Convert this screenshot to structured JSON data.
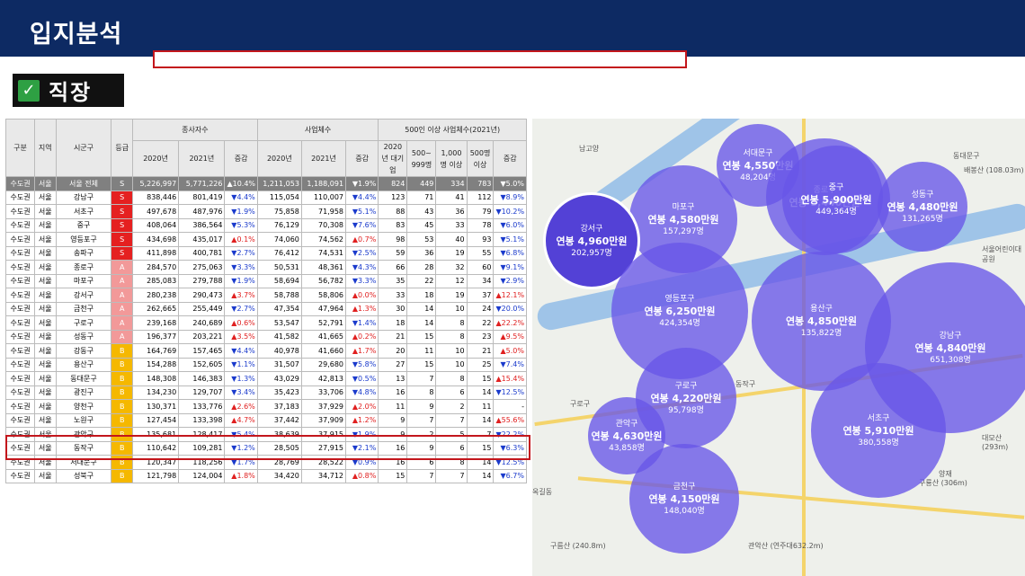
{
  "title": "입지분석",
  "section": "직장",
  "table": {
    "head1": [
      "구분",
      "지역",
      "시군구",
      "등급",
      "종사자수",
      "사업체수",
      "500인 이상 사업체수(2021년)"
    ],
    "head2": [
      "2020년",
      "2021년",
      "증감",
      "2020년",
      "2021년",
      "증감",
      "2020년 대기업",
      "500~ 999명",
      "1,000명 이상",
      "500명 이상",
      "증감"
    ],
    "rows": [
      [
        "수도권",
        "서울",
        "서울 전체",
        "S",
        "5,226,997",
        "5,771,226",
        "▲10.4%",
        "1,211,053",
        "1,188,091",
        "▼1.9%",
        "824",
        "449",
        "334",
        "783",
        "▼5.0%"
      ],
      [
        "수도권",
        "서울",
        "강남구",
        "S",
        "838,446",
        "801,419",
        "▼4.4%",
        "115,054",
        "110,007",
        "▼4.4%",
        "123",
        "71",
        "41",
        "112",
        "▼8.9%"
      ],
      [
        "수도권",
        "서울",
        "서초구",
        "S",
        "497,678",
        "487,976",
        "▼1.9%",
        "75,858",
        "71,958",
        "▼5.1%",
        "88",
        "43",
        "36",
        "79",
        "▼10.2%"
      ],
      [
        "수도권",
        "서울",
        "중구",
        "S",
        "408,064",
        "386,564",
        "▼5.3%",
        "76,129",
        "70,308",
        "▼7.6%",
        "83",
        "45",
        "33",
        "78",
        "▼6.0%"
      ],
      [
        "수도권",
        "서울",
        "영등포구",
        "S",
        "434,698",
        "435,017",
        "▲0.1%",
        "74,060",
        "74,562",
        "▲0.7%",
        "98",
        "53",
        "40",
        "93",
        "▼5.1%"
      ],
      [
        "수도권",
        "서울",
        "송파구",
        "S",
        "411,898",
        "400,781",
        "▼2.7%",
        "76,412",
        "74,531",
        "▼2.5%",
        "59",
        "36",
        "19",
        "55",
        "▼6.8%"
      ],
      [
        "수도권",
        "서울",
        "종로구",
        "A",
        "284,570",
        "275,063",
        "▼3.3%",
        "50,531",
        "48,361",
        "▼4.3%",
        "66",
        "28",
        "32",
        "60",
        "▼9.1%"
      ],
      [
        "수도권",
        "서울",
        "마포구",
        "A",
        "285,083",
        "279,788",
        "▼1.9%",
        "58,694",
        "56,782",
        "▼3.3%",
        "35",
        "22",
        "12",
        "34",
        "▼2.9%"
      ],
      [
        "수도권",
        "서울",
        "강서구",
        "A",
        "280,238",
        "290,473",
        "▲3.7%",
        "58,788",
        "58,806",
        "▲0.0%",
        "33",
        "18",
        "19",
        "37",
        "▲12.1%"
      ],
      [
        "수도권",
        "서울",
        "금천구",
        "A",
        "262,665",
        "255,449",
        "▼2.7%",
        "47,354",
        "47,964",
        "▲1.3%",
        "30",
        "14",
        "10",
        "24",
        "▼20.0%"
      ],
      [
        "수도권",
        "서울",
        "구로구",
        "A",
        "239,168",
        "240,689",
        "▲0.6%",
        "53,547",
        "52,791",
        "▼1.4%",
        "18",
        "14",
        "8",
        "22",
        "▲22.2%"
      ],
      [
        "수도권",
        "서울",
        "성동구",
        "A",
        "196,377",
        "203,221",
        "▲3.5%",
        "41,582",
        "41,665",
        "▲0.2%",
        "21",
        "15",
        "8",
        "23",
        "▲9.5%"
      ],
      [
        "수도권",
        "서울",
        "강동구",
        "B",
        "164,769",
        "157,465",
        "▼4.4%",
        "40,978",
        "41,660",
        "▲1.7%",
        "20",
        "11",
        "10",
        "21",
        "▲5.0%"
      ],
      [
        "수도권",
        "서울",
        "용산구",
        "B",
        "154,288",
        "152,605",
        "▼1.1%",
        "31,507",
        "29,680",
        "▼5.8%",
        "27",
        "15",
        "10",
        "25",
        "▼7.4%"
      ],
      [
        "수도권",
        "서울",
        "동대문구",
        "B",
        "148,308",
        "146,383",
        "▼1.3%",
        "43,029",
        "42,813",
        "▼0.5%",
        "13",
        "7",
        "8",
        "15",
        "▲15.4%"
      ],
      [
        "수도권",
        "서울",
        "광진구",
        "B",
        "134,230",
        "129,707",
        "▼3.4%",
        "35,423",
        "33,706",
        "▼4.8%",
        "16",
        "8",
        "6",
        "14",
        "▼12.5%"
      ],
      [
        "수도권",
        "서울",
        "양천구",
        "B",
        "130,371",
        "133,776",
        "▲2.6%",
        "37,183",
        "37,929",
        "▲2.0%",
        "11",
        "9",
        "2",
        "11",
        "-"
      ],
      [
        "수도권",
        "서울",
        "노원구",
        "B",
        "127,454",
        "133,398",
        "▲4.7%",
        "37,442",
        "37,909",
        "▲1.2%",
        "9",
        "7",
        "7",
        "14",
        "▲55.6%"
      ],
      [
        "수도권",
        "서울",
        "관악구",
        "B",
        "135,681",
        "128,417",
        "▼5.4%",
        "38,639",
        "37,915",
        "▼1.9%",
        "9",
        "2",
        "5",
        "7",
        "▼22.2%"
      ],
      [
        "수도권",
        "서울",
        "동작구",
        "B",
        "110,642",
        "109,281",
        "▼1.2%",
        "28,505",
        "27,915",
        "▼2.1%",
        "16",
        "9",
        "6",
        "15",
        "▼6.3%"
      ],
      [
        "수도권",
        "서울",
        "서대문구",
        "B",
        "120,347",
        "118,256",
        "▼1.7%",
        "28,769",
        "28,522",
        "▼0.9%",
        "16",
        "6",
        "8",
        "14",
        "▼12.5%"
      ],
      [
        "수도권",
        "서울",
        "성북구",
        "B",
        "121,798",
        "124,004",
        "▲1.8%",
        "34,420",
        "34,712",
        "▲0.8%",
        "15",
        "7",
        "7",
        "14",
        "▼6.7%"
      ]
    ]
  },
  "map": {
    "bubbles": [
      {
        "name": "서대문구",
        "salary": "연봉 4,550만원",
        "count": "48,204명"
      },
      {
        "name": "마포구",
        "salary": "연봉 4,580만원",
        "count": "157,297명"
      },
      {
        "name": "종로구",
        "salary": "연봉 5,440만원",
        "count": ""
      },
      {
        "name": "중구",
        "salary": "연봉 5,900만원",
        "count": "449,364명"
      },
      {
        "name": "성동구",
        "salary": "연봉 4,480만원",
        "count": "131,265명"
      },
      {
        "name": "강서구",
        "salary": "연봉 4,960만원",
        "count": "202,957명"
      },
      {
        "name": "영등포구",
        "salary": "연봉 6,250만원",
        "count": "424,354명"
      },
      {
        "name": "용산구",
        "salary": "연봉 4,850만원",
        "count": "135,822명"
      },
      {
        "name": "강남구",
        "salary": "연봉 4,840만원",
        "count": "651,308명"
      },
      {
        "name": "구로구",
        "salary": "연봉 4,220만원",
        "count": "95,798명"
      },
      {
        "name": "관악구",
        "salary": "연봉 4,630만원",
        "count": "43,858명"
      },
      {
        "name": "서초구",
        "salary": "연봉 5,910만원",
        "count": "380,558명"
      },
      {
        "name": "금천구",
        "salary": "연봉 4,150만원",
        "count": "148,040명"
      }
    ],
    "labels": [
      "동작구",
      "구로구",
      "동대문구",
      "남고양",
      "배봉산 (108.03m)",
      "서울어린이대공원",
      "대모산 (293m)",
      "구룡산 (306m)",
      "관악산 (연주대632.2m)",
      "구름산 (240.8m)",
      "옥길동",
      "양재"
    ]
  }
}
